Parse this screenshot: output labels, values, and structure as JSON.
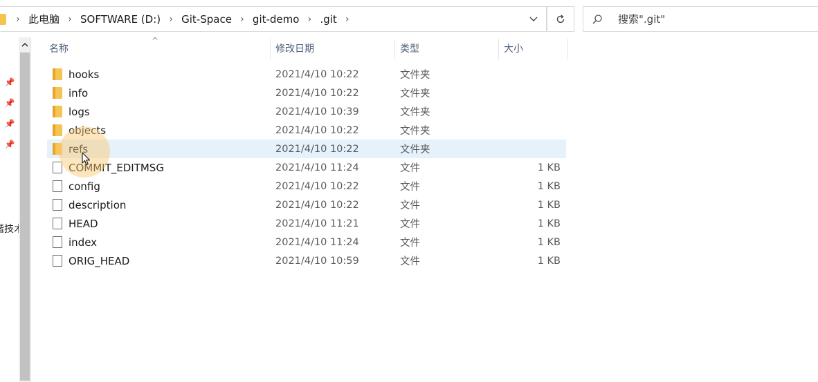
{
  "address": {
    "breadcrumbs": [
      "此电脑",
      "SOFTWARE (D:)",
      "Git-Space",
      "git-demo",
      ".git"
    ]
  },
  "search": {
    "placeholder": "搜索\".git\""
  },
  "nav": {
    "partial_label": "谐技术"
  },
  "columns": {
    "name": "名称",
    "modified": "修改日期",
    "type": "类型",
    "size": "大小"
  },
  "files": [
    {
      "name": "hooks",
      "modified": "2021/4/10 10:22",
      "type": "文件夹",
      "size": "",
      "icon": "folder-icon"
    },
    {
      "name": "info",
      "modified": "2021/4/10 10:22",
      "type": "文件夹",
      "size": "",
      "icon": "folder-icon"
    },
    {
      "name": "logs",
      "modified": "2021/4/10 10:39",
      "type": "文件夹",
      "size": "",
      "icon": "folder-icon"
    },
    {
      "name": "objects",
      "modified": "2021/4/10 10:22",
      "type": "文件夹",
      "size": "",
      "icon": "folder-icon"
    },
    {
      "name": "refs",
      "modified": "2021/4/10 10:22",
      "type": "文件夹",
      "size": "",
      "icon": "folder-icon"
    },
    {
      "name": "COMMIT_EDITMSG",
      "modified": "2021/4/10 11:24",
      "type": "文件",
      "size": "1 KB",
      "icon": "file-icon"
    },
    {
      "name": "config",
      "modified": "2021/4/10 10:22",
      "type": "文件",
      "size": "1 KB",
      "icon": "file-icon"
    },
    {
      "name": "description",
      "modified": "2021/4/10 10:22",
      "type": "文件",
      "size": "1 KB",
      "icon": "file-icon"
    },
    {
      "name": "HEAD",
      "modified": "2021/4/10 11:21",
      "type": "文件",
      "size": "1 KB",
      "icon": "file-icon"
    },
    {
      "name": "index",
      "modified": "2021/4/10 11:24",
      "type": "文件",
      "size": "1 KB",
      "icon": "file-icon"
    },
    {
      "name": "ORIG_HEAD",
      "modified": "2021/4/10 10:59",
      "type": "文件",
      "size": "1 KB",
      "icon": "file-icon"
    }
  ],
  "selected_index": 4,
  "colors": {
    "selection": "#e5f1fb",
    "folder": "#f6c453",
    "header_text": "#4c607a"
  }
}
